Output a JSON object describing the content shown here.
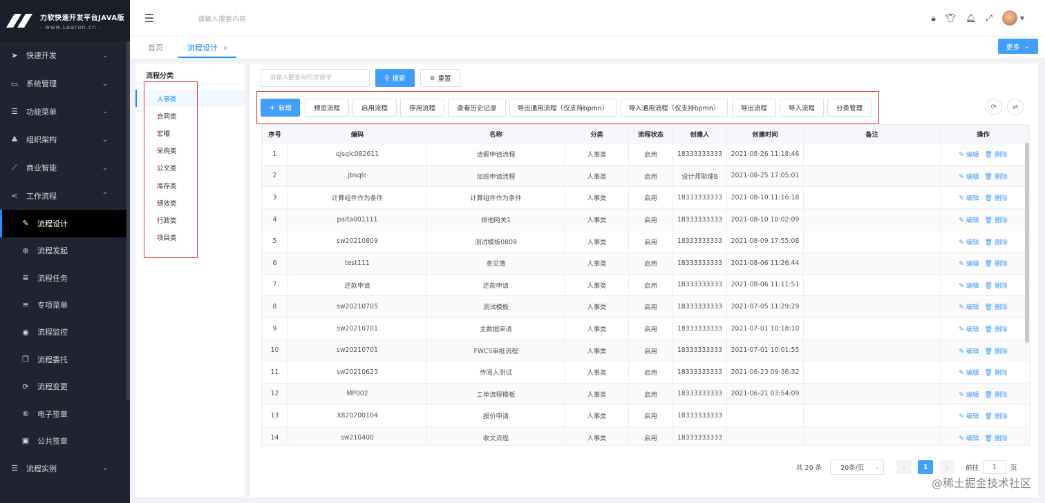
{
  "app": {
    "title": "力软快速开发平台JAVA版",
    "subtitle": "- www.Learun.cn -"
  },
  "sidebar": {
    "items": [
      {
        "label": "快速开发",
        "icon": "send-icon",
        "expand": "collapsed"
      },
      {
        "label": "系统管理",
        "icon": "monitor-icon",
        "expand": "collapsed"
      },
      {
        "label": "功能菜单",
        "icon": "list-icon",
        "expand": "collapsed"
      },
      {
        "label": "组织架构",
        "icon": "org-chart-icon",
        "expand": "collapsed"
      },
      {
        "label": "商业智能",
        "icon": "line-chart-icon",
        "expand": "collapsed"
      },
      {
        "label": "工作流程",
        "icon": "share-icon",
        "expand": "expanded"
      }
    ],
    "workflow_children": [
      {
        "label": "流程设计",
        "icon": "edit-icon",
        "active": true
      },
      {
        "label": "流程发起",
        "icon": "plus-circle-icon"
      },
      {
        "label": "流程任务",
        "icon": "tasks-icon"
      },
      {
        "label": "专项菜单",
        "icon": "bars-icon"
      },
      {
        "label": "流程监控",
        "icon": "eye-icon"
      },
      {
        "label": "流程委托",
        "icon": "copy-icon"
      },
      {
        "label": "流程变更",
        "icon": "refresh-icon"
      },
      {
        "label": "电子签章",
        "icon": "registered-icon"
      },
      {
        "label": "公共签章",
        "icon": "image-icon"
      }
    ],
    "last_item": {
      "label": "流程实例",
      "icon": "list-icon",
      "expand": "collapsed"
    }
  },
  "topbar": {
    "search_placeholder": "请输入搜索内容"
  },
  "tabs": [
    {
      "label": "首页",
      "active": false
    },
    {
      "label": "流程设计",
      "active": true,
      "closable": true
    }
  ],
  "more_button": "更多",
  "category": {
    "title": "流程分类",
    "items": [
      "人事类",
      "合同类",
      "宏嘟",
      "采购类",
      "公文类",
      "库存类",
      "绩效类",
      "行政类",
      "项目类"
    ],
    "active_index": 0
  },
  "query": {
    "keyword_placeholder": "请输入要查询的关键字",
    "search_label": "搜索",
    "reset_label": "重置"
  },
  "toolbar": {
    "new_label": "新增",
    "preview_label": "预览流程",
    "enable_label": "启用流程",
    "disable_label": "停用流程",
    "history_label": "查看历史记录",
    "export_common_label": "导出通用流程（仅支持bpmn）",
    "import_common_label": "导入通用流程（仅支持bpmn）",
    "export_label": "导出流程",
    "import_label": "导入流程",
    "category_mgmt_label": "分类管理"
  },
  "table": {
    "columns": [
      "序号",
      "编码",
      "名称",
      "分类",
      "流程状态",
      "创建人",
      "创建时间",
      "备注",
      "操作"
    ],
    "edit_label": "编辑",
    "delete_label": "删除",
    "rows": [
      [
        "1",
        "qjsqlc082611",
        "请假申请流程",
        "人事类",
        "启用",
        "18333333333",
        "2021-08-26 11:18:46",
        ""
      ],
      [
        "2",
        "jbsqlc",
        "加班申请流程",
        "人事类",
        "启用",
        "设计师助理B",
        "2021-08-25 17:05:01",
        ""
      ],
      [
        "3",
        "计算组件作为条件",
        "计算组件作为条件",
        "人事类",
        "启用",
        "18333333333",
        "2021-08-10 11:16:18",
        ""
      ],
      [
        "4",
        "paita001111",
        "排他网关1",
        "人事类",
        "启用",
        "18333333333",
        "2021-08-10 10:02:09",
        ""
      ],
      [
        "5",
        "sw20210809",
        "测试模板0809",
        "人事类",
        "启用",
        "18333333333",
        "2021-08-09 17:55:08",
        ""
      ],
      [
        "6",
        "test111",
        "意见簿",
        "人事类",
        "启用",
        "18333333333",
        "2021-08-06 11:26:44",
        ""
      ],
      [
        "7",
        "还款申请",
        "还款申请",
        "人事类",
        "启用",
        "18333333333",
        "2021-08-06 11:11:51",
        ""
      ],
      [
        "8",
        "sw20210705",
        "测试模板",
        "人事类",
        "启用",
        "18333333333",
        "2021-07-05 11:29:29",
        ""
      ],
      [
        "9",
        "sw20210701",
        "主数据审请",
        "人事类",
        "启用",
        "18333333333",
        "2021-07-01 10:18:10",
        ""
      ],
      [
        "10",
        "sw20210701",
        "FWCS审批流程",
        "人事类",
        "启用",
        "18333333333",
        "2021-07-01 10:01:55",
        ""
      ],
      [
        "11",
        "sw20210623",
        "传阅人测试",
        "人事类",
        "启用",
        "18333333333",
        "2021-06-23 09:36:32",
        ""
      ],
      [
        "12",
        "MP002",
        "工单流程模板",
        "人事类",
        "启用",
        "18333333333",
        "2021-06-21 03:54:09",
        ""
      ],
      [
        "13",
        "X820200104",
        "报价申请",
        "人事类",
        "启用",
        "18333333333",
        "",
        ""
      ],
      [
        "14",
        "sw210400",
        "收文流程",
        "人事类",
        "启用",
        "18333333333",
        "",
        ""
      ]
    ]
  },
  "pagination": {
    "total_text": "共 20 条",
    "page_size": "20条/页",
    "current_page": "1",
    "goto_label": "前往",
    "goto_value": "1",
    "page_unit": "页"
  },
  "watermark": "@稀土掘金技术社区"
}
